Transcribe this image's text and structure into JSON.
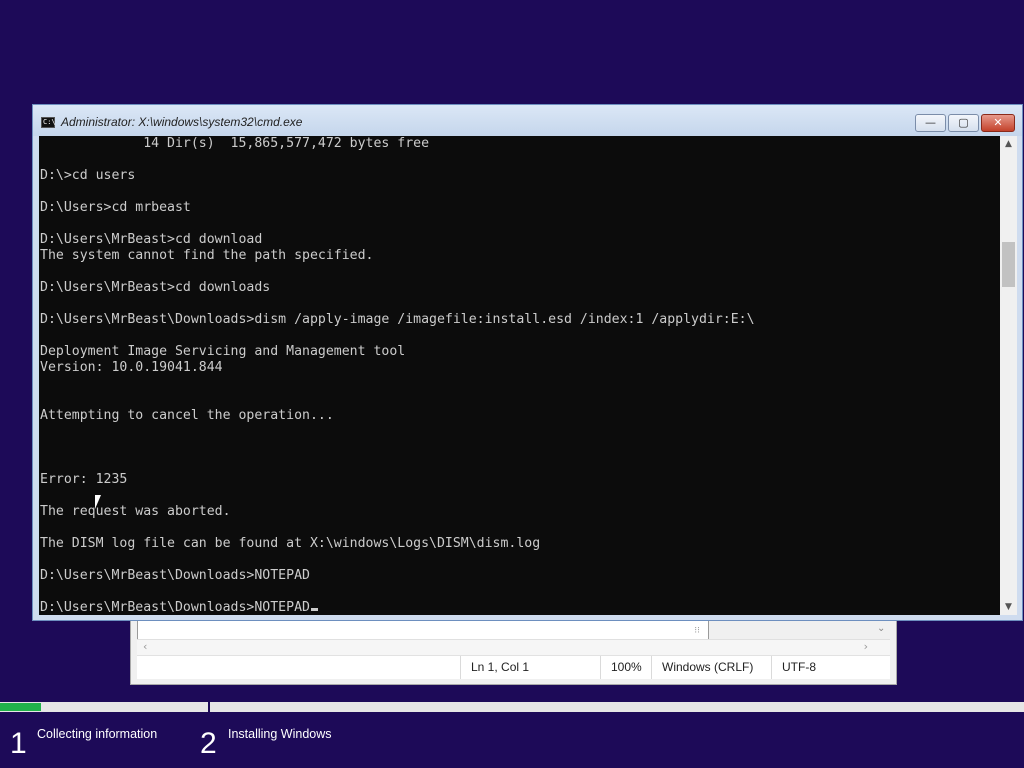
{
  "notepad": {
    "status": {
      "position": "Ln 1, Col 1",
      "zoom": "100%",
      "line_ending": "Windows (CRLF)",
      "encoding": "UTF-8"
    }
  },
  "cmd": {
    "title": "Administrator: X:\\windows\\system32\\cmd.exe",
    "icon_label": "C:\\",
    "buttons": {
      "minimize": "—",
      "maximize": "▢",
      "close": "✕"
    },
    "lines": [
      "             14 Dir(s)  15,865,577,472 bytes free",
      "",
      "D:\\>cd users",
      "",
      "D:\\Users>cd mrbeast",
      "",
      "D:\\Users\\MrBeast>cd download",
      "The system cannot find the path specified.",
      "",
      "D:\\Users\\MrBeast>cd downloads",
      "",
      "D:\\Users\\MrBeast\\Downloads>dism /apply-image /imagefile:install.esd /index:1 /applydir:E:\\",
      "",
      "Deployment Image Servicing and Management tool",
      "Version: 10.0.19041.844",
      "",
      "",
      "Attempting to cancel the operation...",
      "",
      "",
      "",
      "Error: 1235",
      "",
      "The request was aborted.",
      "",
      "The DISM log file can be found at X:\\windows\\Logs\\DISM\\dism.log",
      "",
      "D:\\Users\\MrBeast\\Downloads>NOTEPAD",
      "",
      "D:\\Users\\MrBeast\\Downloads>NOTEPAD"
    ]
  },
  "setup": {
    "progress": 0.04,
    "steps": [
      {
        "number": "1",
        "label": "Collecting information"
      },
      {
        "number": "2",
        "label": "Installing Windows"
      }
    ],
    "colors": {
      "background": "#1d0a58",
      "progress": "#21b24b"
    }
  }
}
